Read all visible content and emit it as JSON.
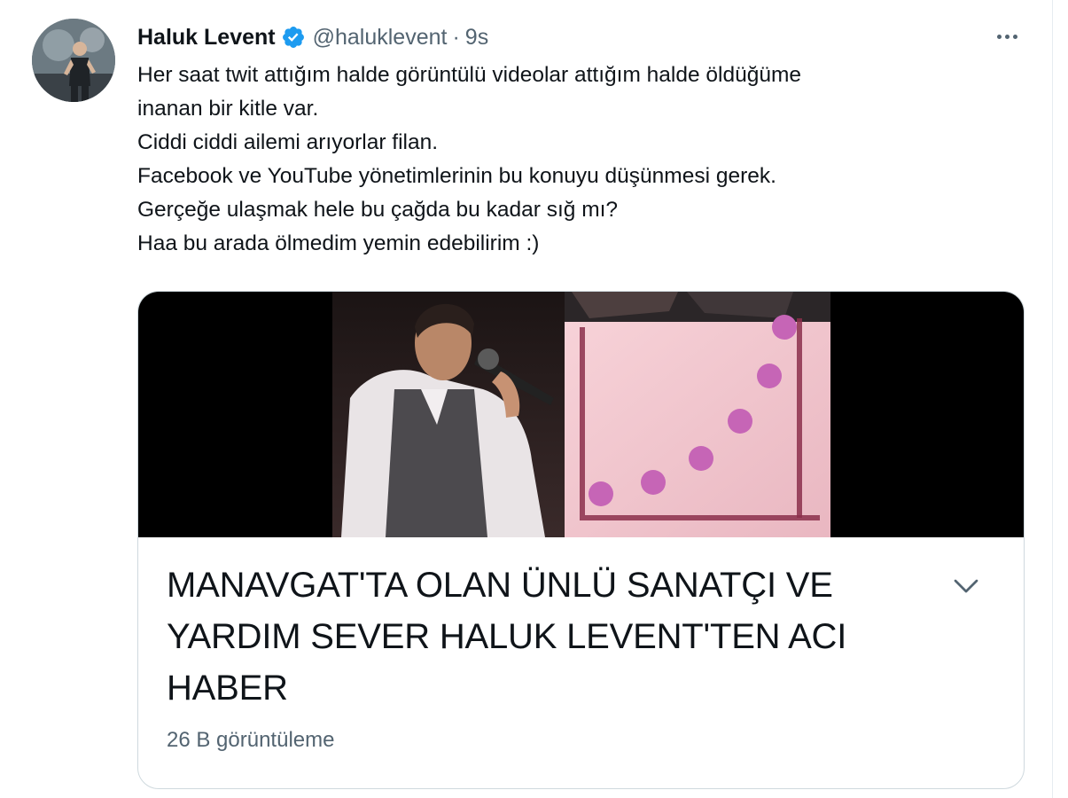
{
  "user": {
    "name": "Haluk Levent",
    "handle": "@haluklevent",
    "separator": "·",
    "time": "9s",
    "verified": true,
    "avatar_icon": "avatar-singer-photo"
  },
  "tweet": {
    "lines": [
      "Her saat twit attığım halde görüntülü videolar attığım halde öldüğüme",
      "inanan bir kitle var.",
      "Ciddi ciddi ailemi arıyorlar filan.",
      "Facebook ve YouTube yönetimlerinin bu konuyu düşünmesi gerek.",
      "Gerçeğe ulaşmak hele bu çağda bu kadar sığ mı?",
      "Haa bu arada ölmedim yemin edebilirim :)"
    ]
  },
  "card": {
    "headline": "MANAVGAT'TA OLAN ÜNLÜ SANATÇI VE YARDIM SEVER HALUK LEVENT'TEN ACI HABER",
    "views": "26 B görüntüleme",
    "media_icon": "news-thumbnail-image",
    "expand_icon": "chevron-down-icon"
  },
  "icons": {
    "verified": "verified-badge-icon",
    "more": "more-options-icon"
  },
  "colors": {
    "text": "#0f1419",
    "secondary": "#536471",
    "verified": "#1d9bf0",
    "border": "#cfd9de"
  }
}
